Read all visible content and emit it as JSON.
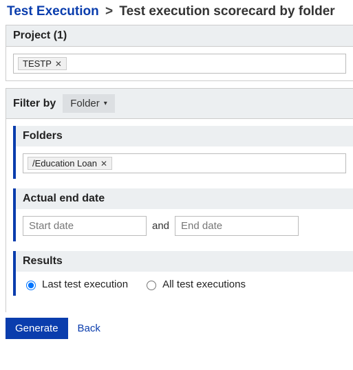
{
  "breadcrumb": {
    "root": "Test Execution",
    "sep": ">",
    "current": "Test execution scorecard by folder"
  },
  "project": {
    "header": "Project (1)",
    "tags": [
      {
        "label": "TESTP"
      }
    ]
  },
  "filter": {
    "label": "Filter by",
    "selected": "Folder"
  },
  "sections": {
    "folders": {
      "title": "Folders",
      "tags": [
        {
          "label": "/Education Loan"
        }
      ]
    },
    "actual_end_date": {
      "title": "Actual end date",
      "start_placeholder": "Start date",
      "and": "and",
      "end_placeholder": "End date"
    },
    "results": {
      "title": "Results",
      "options": {
        "last": "Last test execution",
        "all": "All test executions"
      },
      "selected": "last"
    }
  },
  "actions": {
    "generate": "Generate",
    "back": "Back"
  }
}
